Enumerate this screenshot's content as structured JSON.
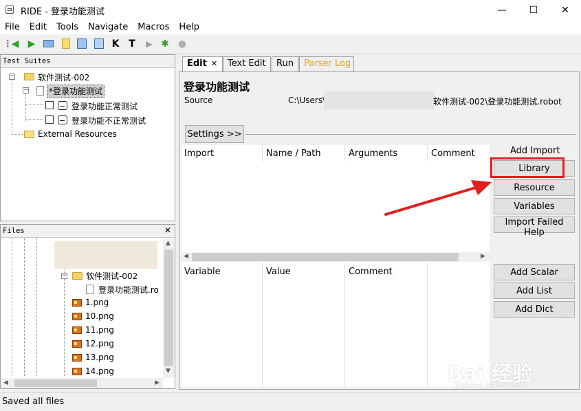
{
  "window": {
    "title": "RIDE - 登录功能测试",
    "minimize": "—",
    "maximize": "☐",
    "close": "✕"
  },
  "menu": [
    "File",
    "Edit",
    "Tools",
    "Navigate",
    "Macros",
    "Help"
  ],
  "toolbar": {
    "k_label": "K",
    "t_label": "T"
  },
  "test_suites": {
    "header": "Test Suites",
    "root": "软件测试-002",
    "suite": "*登录功能测试",
    "cases": [
      "登录功能正常测试",
      "登录功能不正常测试"
    ],
    "external": "External Resources"
  },
  "files": {
    "header": "Files",
    "close": "✕",
    "folder": "软件测试-002",
    "robot_file": "登录功能测试.ro",
    "images": [
      "1.png",
      "10.png",
      "11.png",
      "12.png",
      "13.png",
      "14.png"
    ]
  },
  "tabs": [
    "Edit",
    "Text Edit",
    "Run",
    "Parser Log"
  ],
  "tab_close": "✕",
  "editor": {
    "title": "登录功能测试",
    "source_label": "Source",
    "source_prefix": "C:\\Users\\",
    "source_suffix": "软件测试-002\\登录功能测试.robot",
    "settings_button": "Settings >>",
    "import_columns": [
      "Import",
      "Name / Path",
      "Arguments",
      "Comment"
    ],
    "add_import_label": "Add Import",
    "import_buttons": [
      "Library",
      "Resource",
      "Variables",
      "Import Failed Help"
    ],
    "variable_columns": [
      "Variable",
      "Value",
      "Comment"
    ],
    "variable_buttons": [
      "Add Scalar",
      "Add List",
      "Add Dict"
    ]
  },
  "status_bar": {
    "text": "Saved all files"
  },
  "watermark": {
    "text": "Bai 经验",
    "sub": "jingyan.baidu.com"
  },
  "colors": {
    "highlight_red": "#e02020",
    "parser_log_tab": "#e8a020",
    "selection": "#cfcfcf"
  }
}
